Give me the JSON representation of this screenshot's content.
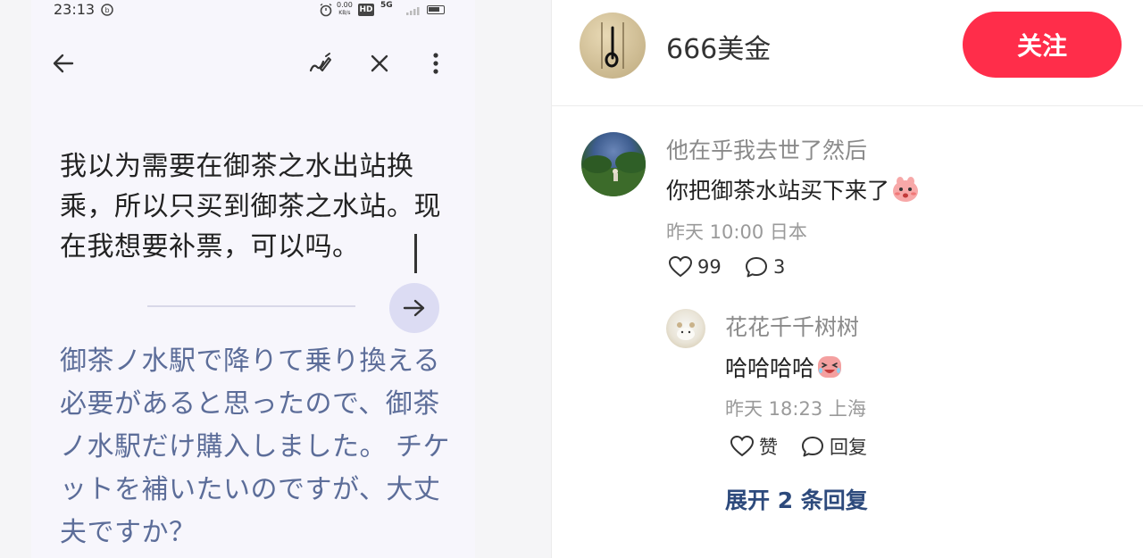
{
  "status_bar": {
    "time": "23:13",
    "speed_top": "0.00",
    "speed_bottom": "KB/s",
    "hd_label": "HD",
    "net_label": "5G"
  },
  "translator": {
    "source_text": "我以为需要在御茶之水出站换乘，所以只买到御茶之水站。现在我想要补票，可以吗。",
    "translated_text": "御茶ノ水駅で降りて乗り換える必要があると思ったので、御茶ノ水駅だけ購入しました。 チケットを補いたいのですが、大丈夫ですか？"
  },
  "post_header": {
    "author_name": "666美金",
    "follow_label": "关注"
  },
  "comments": [
    {
      "user": "他在乎我去世了然后",
      "text": "你把御茶水站买下来了",
      "meta": "昨天 10:00 日本",
      "likes": "99",
      "replies": "3"
    }
  ],
  "reply": {
    "user": "花花千千树树",
    "text": "哈哈哈哈",
    "meta": "昨天 18:23 上海",
    "like_label": "赞",
    "reply_label": "回复"
  },
  "expand_label": "展开 2 条回复",
  "colors": {
    "accent": "#ff2d4a",
    "translation_text": "#5c6d99",
    "link": "#2d4a7c"
  }
}
